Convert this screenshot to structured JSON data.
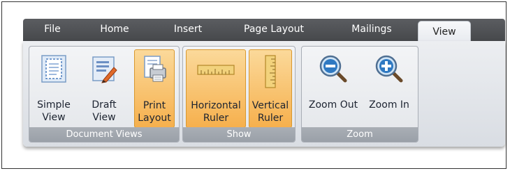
{
  "tabs": [
    {
      "label": "File"
    },
    {
      "label": "Home"
    },
    {
      "label": "Insert"
    },
    {
      "label": "Page Layout"
    },
    {
      "label": "Mailings"
    },
    {
      "label": "View",
      "active": true
    }
  ],
  "groups": {
    "document_views": {
      "label": "Document Views",
      "buttons": {
        "simple_view": {
          "label": "Simple\nView",
          "icon": "simple-view-icon",
          "pressed": false
        },
        "draft_view": {
          "label": "Draft\nView",
          "icon": "draft-view-icon",
          "pressed": false
        },
        "print_layout": {
          "label": "Print\nLayout",
          "icon": "print-layout-icon",
          "pressed": true
        }
      }
    },
    "show": {
      "label": "Show",
      "buttons": {
        "horizontal_ruler": {
          "label": "Horizontal\nRuler",
          "icon": "horizontal-ruler-icon",
          "pressed": true
        },
        "vertical_ruler": {
          "label": "Vertical\nRuler",
          "icon": "vertical-ruler-icon",
          "pressed": true
        }
      }
    },
    "zoom": {
      "label": "Zoom",
      "buttons": {
        "zoom_out": {
          "label": "Zoom Out",
          "icon": "zoom-out-icon",
          "pressed": false
        },
        "zoom_in": {
          "label": "Zoom In",
          "icon": "zoom-in-icon",
          "pressed": false
        }
      }
    }
  },
  "colors": {
    "tabbar": "#4f5155",
    "pressed": "#f6b04d",
    "group_label_bg": "#a3a8b0"
  }
}
